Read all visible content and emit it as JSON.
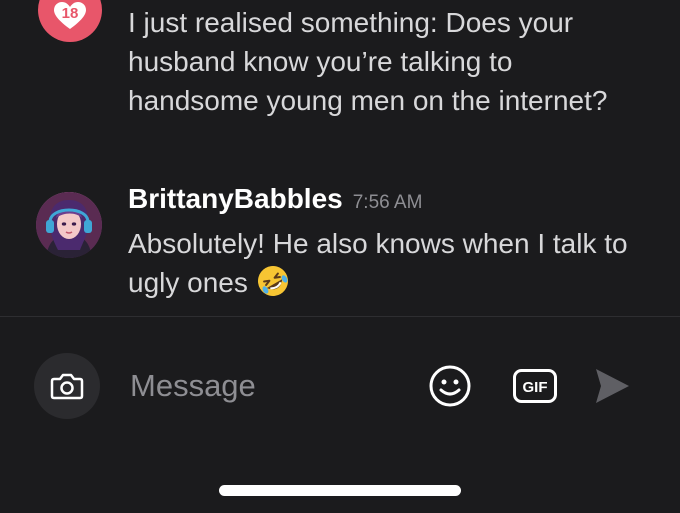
{
  "messages": [
    {
      "text": "I just realised something: Does your husband know you’re talking to handsome young men on the internet?",
      "badge_number": "18"
    },
    {
      "author": "BrittanyBabbles",
      "time": "7:56 AM",
      "text": "Absolutely! He also knows when I talk to ugly ones",
      "emoji": "rolling-on-floor-laughing-icon"
    }
  ],
  "composer": {
    "placeholder": "Message",
    "gif_label": "GIF"
  },
  "colors": {
    "badge": "#e8566a",
    "background": "#1b1b1d",
    "muted_text": "#8e8e93"
  }
}
